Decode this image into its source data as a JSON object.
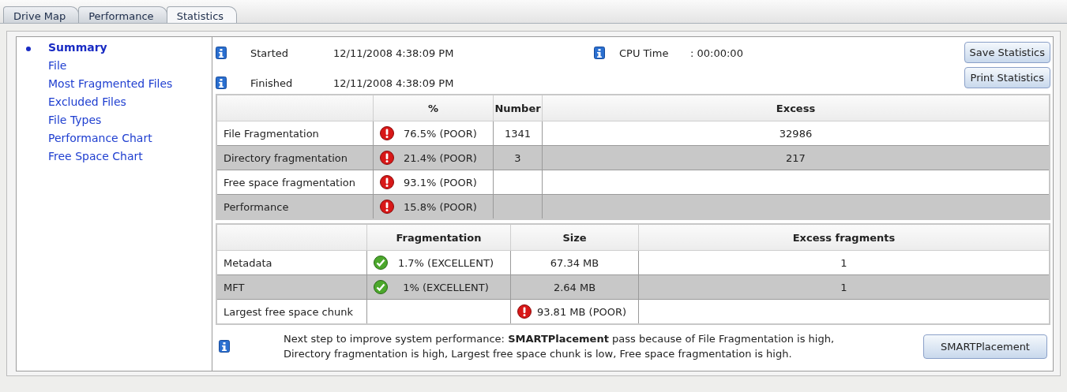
{
  "tabs": [
    {
      "label": "Drive Map",
      "selected": false
    },
    {
      "label": "Performance",
      "selected": false
    },
    {
      "label": "Statistics",
      "selected": true
    }
  ],
  "sidebar": {
    "items": [
      {
        "label": "Summary",
        "selected": true
      },
      {
        "label": "File",
        "selected": false
      },
      {
        "label": "Most Fragmented Files",
        "selected": false
      },
      {
        "label": "Excluded Files",
        "selected": false
      },
      {
        "label": "File Types",
        "selected": false
      },
      {
        "label": "Performance Chart",
        "selected": false
      },
      {
        "label": "Free Space Chart",
        "selected": false
      }
    ]
  },
  "times": [
    {
      "label": "Started",
      "value": "12/11/2008 4:38:09 PM"
    },
    {
      "label": "Finished",
      "value": "12/11/2008 4:38:09 PM"
    }
  ],
  "cpu_time": {
    "label": "CPU Time",
    "value": ": 00:00:00"
  },
  "buttons": [
    "Save Statistics",
    "Print Statistics"
  ],
  "fragmentation_table": {
    "columns": [
      "%",
      "Number",
      "Excess"
    ],
    "rows": [
      {
        "name": "File Fragmentation",
        "cells": [
          {
            "text": "76.5% (POOR)",
            "kind": "poor"
          },
          {
            "text": "1341"
          },
          {
            "text": "32986"
          }
        ]
      },
      {
        "name": "Directory fragmentation",
        "cells": [
          {
            "text": "21.4% (POOR)",
            "kind": "poor"
          },
          {
            "text": "3"
          },
          {
            "text": "217"
          }
        ]
      },
      {
        "name": "Free space fragmentation",
        "cells": [
          {
            "text": "93.1% (POOR)",
            "kind": "poor"
          },
          {},
          {}
        ]
      },
      {
        "name": "Performance",
        "cells": [
          {
            "text": "15.8% (POOR)",
            "kind": "poor"
          },
          {},
          {}
        ]
      }
    ]
  },
  "metadata_table": {
    "columns": [
      "Fragmentation",
      "Size",
      "Excess fragments"
    ],
    "rows": [
      {
        "name": "Metadata",
        "cells": [
          {
            "text": "1.7% (EXCELLENT)",
            "kind": "excellent"
          },
          {
            "text": "67.34 MB"
          },
          {
            "text": "1"
          }
        ]
      },
      {
        "name": "MFT",
        "cells": [
          {
            "text": "1% (EXCELLENT)",
            "kind": "excellent"
          },
          {
            "text": "2.64 MB"
          },
          {
            "text": "1"
          }
        ]
      },
      {
        "name": "Largest free space chunk",
        "cells": [
          {},
          {
            "text": "93.81 MB (POOR)",
            "kind": "poor"
          },
          {}
        ]
      }
    ]
  },
  "recommendation": {
    "lines": [
      "Next step to improve system performance: **SMARTPlacement** pass because of File Fragmentation is high,",
      "Directory fragmentation is high, Largest free space chunk is low, Free space fragmentation is high."
    ],
    "button": "SMARTPlacement"
  }
}
